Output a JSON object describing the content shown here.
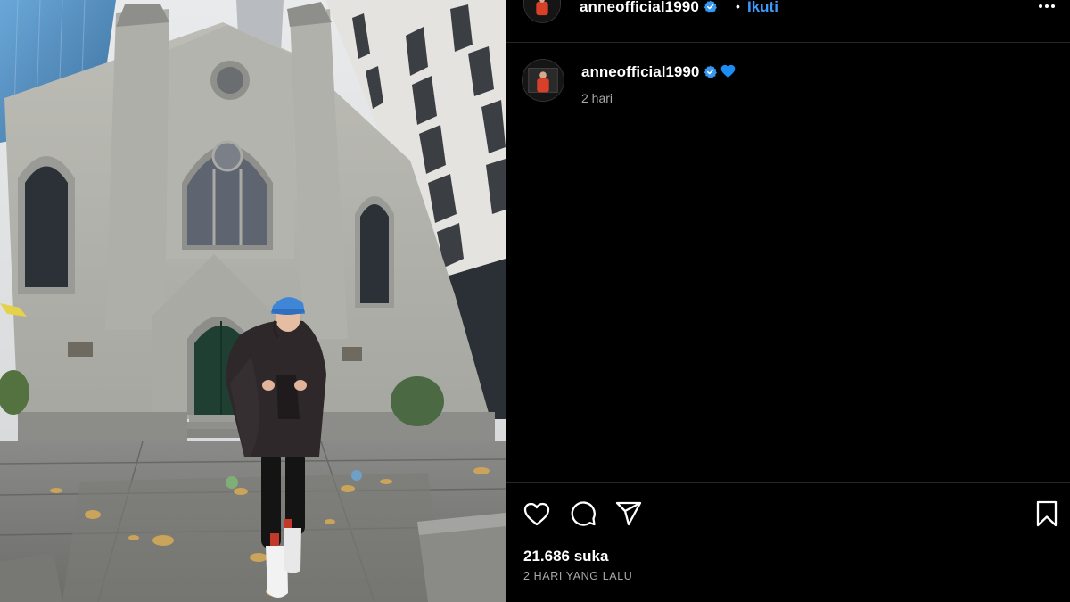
{
  "post": {
    "username": "anneofficial1990",
    "separator": "•",
    "follow_label": "Ikuti",
    "caption_time": "2 hari",
    "likes": "21.686 suka",
    "posted_ago": "2 HARI YANG LALU"
  },
  "icons": {
    "verified": "verified-badge-icon",
    "more": "more-options-icon",
    "caption_emoji": "blue-heart-emoji-icon",
    "like": "heart-icon",
    "comment": "comment-icon",
    "share": "share-paper-plane-icon",
    "save": "bookmark-icon"
  },
  "colors": {
    "background": "#000000",
    "link_blue": "#3d9bff",
    "verified_blue": "#3897f0",
    "secondary_text": "#a8a8a8",
    "divider": "#262626"
  }
}
